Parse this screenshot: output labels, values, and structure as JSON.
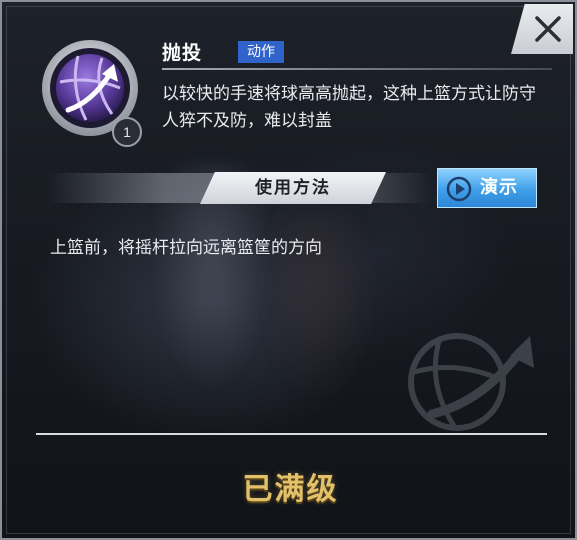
{
  "skill": {
    "name": "抛投",
    "type_tag": "动作",
    "level": "1",
    "description": "以较快的手速将球高高抛起，这种上篮方式让防守人猝不及防，难以封盖",
    "icon": "basketball-arrow-icon"
  },
  "usage": {
    "section_label": "使用方法",
    "demo_label": "演示",
    "demo_icon": "play-icon",
    "instructions": "上篮前，将摇杆拉向远离篮筐的方向"
  },
  "status": {
    "label": "已满级"
  },
  "controls": {
    "close_icon": "close-icon"
  },
  "colors": {
    "tag_blue": "#2f63c9",
    "demo_blue": "#3f9fe8",
    "status_gold": "#e2c16a",
    "icon_purple": "#7a55c8"
  }
}
